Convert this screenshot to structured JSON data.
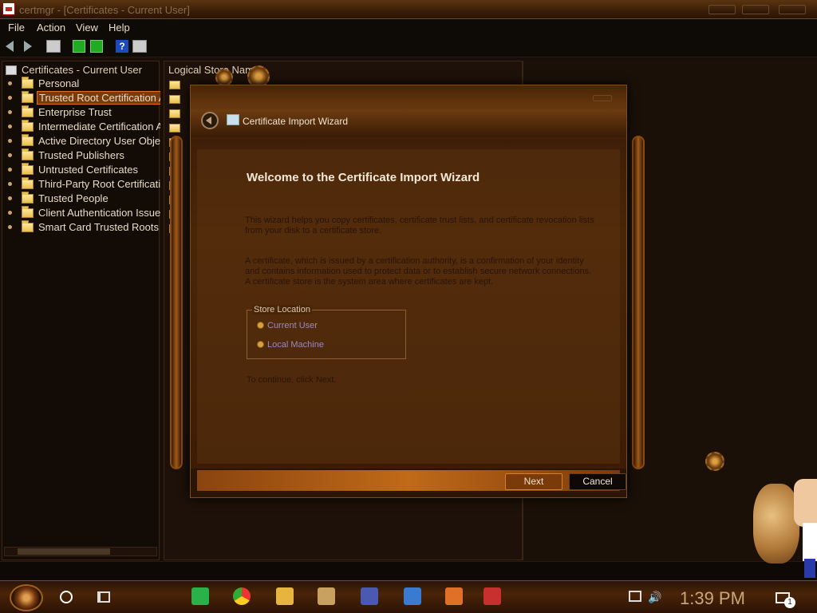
{
  "window": {
    "title": "certmgr - [Certificates - Current User]"
  },
  "menu": [
    "File",
    "Action",
    "View",
    "Help"
  ],
  "tree": {
    "root": "Certificates - Current User",
    "items": [
      {
        "label": "Personal",
        "selected": false
      },
      {
        "label": "Trusted Root Certification A",
        "selected": true
      },
      {
        "label": "Enterprise Trust",
        "selected": false
      },
      {
        "label": "Intermediate Certification A",
        "selected": false
      },
      {
        "label": "Active Directory User Obje",
        "selected": false
      },
      {
        "label": "Trusted Publishers",
        "selected": false
      },
      {
        "label": "Untrusted Certificates",
        "selected": false
      },
      {
        "label": "Third-Party Root Certificati",
        "selected": false
      },
      {
        "label": "Trusted People",
        "selected": false
      },
      {
        "label": "Client Authentication Issue",
        "selected": false
      },
      {
        "label": "Smart Card Trusted Roots",
        "selected": false
      }
    ]
  },
  "content": {
    "column_header": "Logical Store Name"
  },
  "wizard": {
    "title": "Certificate Import Wizard",
    "heading": "Welcome to the Certificate Import Wizard",
    "para1": "This wizard helps you copy certificates, certificate trust lists, and certificate revocation lists from your disk to a certificate store.",
    "para2": "A certificate, which is issued by a certification authority, is a confirmation of your identity and contains information used to protect data or to establish secure network connections. A certificate store is the system area where certificates are kept.",
    "store_location_label": "Store Location",
    "options": [
      "Current User",
      "Local Machine"
    ],
    "selected_option": "Current User",
    "continue_text": "To continue, click Next.",
    "next_label": "Next",
    "cancel_label": "Cancel"
  },
  "taskbar": {
    "clock": "1:39 PM",
    "notification_count": "1",
    "apps": [
      "chat-app",
      "chrome",
      "file-explorer",
      "comic-app",
      "network-app",
      "cube-app",
      "java-app",
      "tool-app"
    ]
  },
  "colors": {
    "accent": "#e07020",
    "wizard_bg": "#4a2608",
    "selection": "#7a3a0a"
  }
}
